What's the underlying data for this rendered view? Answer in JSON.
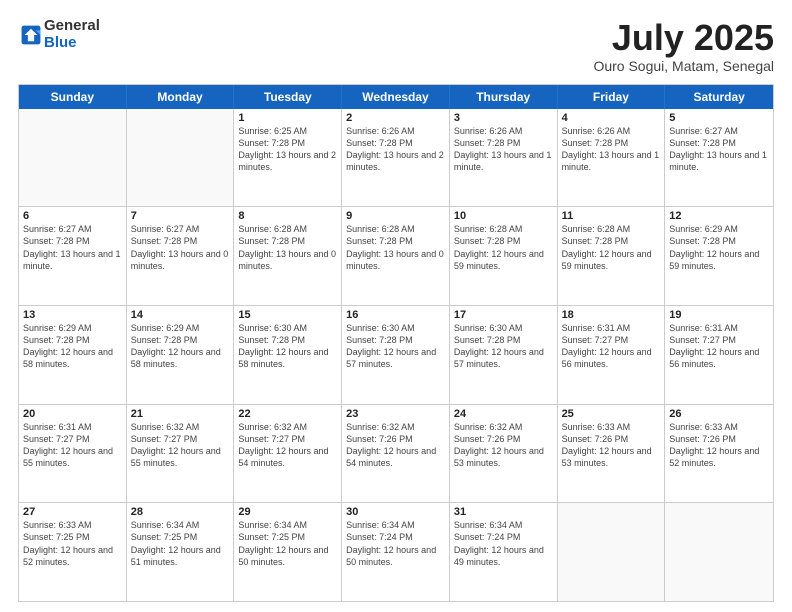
{
  "logo": {
    "general": "General",
    "blue": "Blue"
  },
  "title": {
    "month": "July 2025",
    "location": "Ouro Sogui, Matam, Senegal"
  },
  "header_days": [
    "Sunday",
    "Monday",
    "Tuesday",
    "Wednesday",
    "Thursday",
    "Friday",
    "Saturday"
  ],
  "weeks": [
    [
      {
        "day": "",
        "empty": true
      },
      {
        "day": "",
        "empty": true
      },
      {
        "day": "1",
        "sunrise": "Sunrise: 6:25 AM",
        "sunset": "Sunset: 7:28 PM",
        "daylight": "Daylight: 13 hours and 2 minutes."
      },
      {
        "day": "2",
        "sunrise": "Sunrise: 6:26 AM",
        "sunset": "Sunset: 7:28 PM",
        "daylight": "Daylight: 13 hours and 2 minutes."
      },
      {
        "day": "3",
        "sunrise": "Sunrise: 6:26 AM",
        "sunset": "Sunset: 7:28 PM",
        "daylight": "Daylight: 13 hours and 1 minute."
      },
      {
        "day": "4",
        "sunrise": "Sunrise: 6:26 AM",
        "sunset": "Sunset: 7:28 PM",
        "daylight": "Daylight: 13 hours and 1 minute."
      },
      {
        "day": "5",
        "sunrise": "Sunrise: 6:27 AM",
        "sunset": "Sunset: 7:28 PM",
        "daylight": "Daylight: 13 hours and 1 minute."
      }
    ],
    [
      {
        "day": "6",
        "sunrise": "Sunrise: 6:27 AM",
        "sunset": "Sunset: 7:28 PM",
        "daylight": "Daylight: 13 hours and 1 minute."
      },
      {
        "day": "7",
        "sunrise": "Sunrise: 6:27 AM",
        "sunset": "Sunset: 7:28 PM",
        "daylight": "Daylight: 13 hours and 0 minutes."
      },
      {
        "day": "8",
        "sunrise": "Sunrise: 6:28 AM",
        "sunset": "Sunset: 7:28 PM",
        "daylight": "Daylight: 13 hours and 0 minutes."
      },
      {
        "day": "9",
        "sunrise": "Sunrise: 6:28 AM",
        "sunset": "Sunset: 7:28 PM",
        "daylight": "Daylight: 13 hours and 0 minutes."
      },
      {
        "day": "10",
        "sunrise": "Sunrise: 6:28 AM",
        "sunset": "Sunset: 7:28 PM",
        "daylight": "Daylight: 12 hours and 59 minutes."
      },
      {
        "day": "11",
        "sunrise": "Sunrise: 6:28 AM",
        "sunset": "Sunset: 7:28 PM",
        "daylight": "Daylight: 12 hours and 59 minutes."
      },
      {
        "day": "12",
        "sunrise": "Sunrise: 6:29 AM",
        "sunset": "Sunset: 7:28 PM",
        "daylight": "Daylight: 12 hours and 59 minutes."
      }
    ],
    [
      {
        "day": "13",
        "sunrise": "Sunrise: 6:29 AM",
        "sunset": "Sunset: 7:28 PM",
        "daylight": "Daylight: 12 hours and 58 minutes."
      },
      {
        "day": "14",
        "sunrise": "Sunrise: 6:29 AM",
        "sunset": "Sunset: 7:28 PM",
        "daylight": "Daylight: 12 hours and 58 minutes."
      },
      {
        "day": "15",
        "sunrise": "Sunrise: 6:30 AM",
        "sunset": "Sunset: 7:28 PM",
        "daylight": "Daylight: 12 hours and 58 minutes."
      },
      {
        "day": "16",
        "sunrise": "Sunrise: 6:30 AM",
        "sunset": "Sunset: 7:28 PM",
        "daylight": "Daylight: 12 hours and 57 minutes."
      },
      {
        "day": "17",
        "sunrise": "Sunrise: 6:30 AM",
        "sunset": "Sunset: 7:28 PM",
        "daylight": "Daylight: 12 hours and 57 minutes."
      },
      {
        "day": "18",
        "sunrise": "Sunrise: 6:31 AM",
        "sunset": "Sunset: 7:27 PM",
        "daylight": "Daylight: 12 hours and 56 minutes."
      },
      {
        "day": "19",
        "sunrise": "Sunrise: 6:31 AM",
        "sunset": "Sunset: 7:27 PM",
        "daylight": "Daylight: 12 hours and 56 minutes."
      }
    ],
    [
      {
        "day": "20",
        "sunrise": "Sunrise: 6:31 AM",
        "sunset": "Sunset: 7:27 PM",
        "daylight": "Daylight: 12 hours and 55 minutes."
      },
      {
        "day": "21",
        "sunrise": "Sunrise: 6:32 AM",
        "sunset": "Sunset: 7:27 PM",
        "daylight": "Daylight: 12 hours and 55 minutes."
      },
      {
        "day": "22",
        "sunrise": "Sunrise: 6:32 AM",
        "sunset": "Sunset: 7:27 PM",
        "daylight": "Daylight: 12 hours and 54 minutes."
      },
      {
        "day": "23",
        "sunrise": "Sunrise: 6:32 AM",
        "sunset": "Sunset: 7:26 PM",
        "daylight": "Daylight: 12 hours and 54 minutes."
      },
      {
        "day": "24",
        "sunrise": "Sunrise: 6:32 AM",
        "sunset": "Sunset: 7:26 PM",
        "daylight": "Daylight: 12 hours and 53 minutes."
      },
      {
        "day": "25",
        "sunrise": "Sunrise: 6:33 AM",
        "sunset": "Sunset: 7:26 PM",
        "daylight": "Daylight: 12 hours and 53 minutes."
      },
      {
        "day": "26",
        "sunrise": "Sunrise: 6:33 AM",
        "sunset": "Sunset: 7:26 PM",
        "daylight": "Daylight: 12 hours and 52 minutes."
      }
    ],
    [
      {
        "day": "27",
        "sunrise": "Sunrise: 6:33 AM",
        "sunset": "Sunset: 7:25 PM",
        "daylight": "Daylight: 12 hours and 52 minutes."
      },
      {
        "day": "28",
        "sunrise": "Sunrise: 6:34 AM",
        "sunset": "Sunset: 7:25 PM",
        "daylight": "Daylight: 12 hours and 51 minutes."
      },
      {
        "day": "29",
        "sunrise": "Sunrise: 6:34 AM",
        "sunset": "Sunset: 7:25 PM",
        "daylight": "Daylight: 12 hours and 50 minutes."
      },
      {
        "day": "30",
        "sunrise": "Sunrise: 6:34 AM",
        "sunset": "Sunset: 7:24 PM",
        "daylight": "Daylight: 12 hours and 50 minutes."
      },
      {
        "day": "31",
        "sunrise": "Sunrise: 6:34 AM",
        "sunset": "Sunset: 7:24 PM",
        "daylight": "Daylight: 12 hours and 49 minutes."
      },
      {
        "day": "",
        "empty": true
      },
      {
        "day": "",
        "empty": true
      }
    ]
  ]
}
